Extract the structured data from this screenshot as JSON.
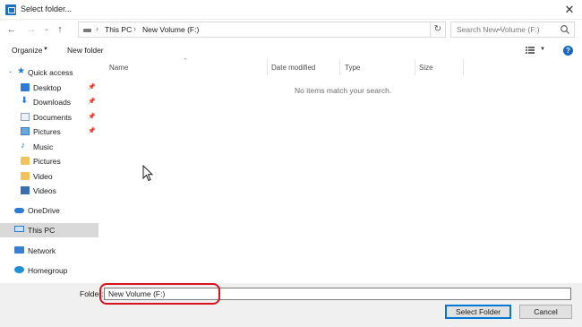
{
  "window": {
    "title": "Select folder..."
  },
  "address": {
    "segments": [
      "This PC",
      "New Volume (F:)"
    ]
  },
  "search": {
    "placeholder": "Search New Volume (F:)"
  },
  "toolbar": {
    "organize": "Organize",
    "new_folder": "New folder"
  },
  "nav": {
    "quick_access": "Quick access",
    "pinned": [
      "Desktop",
      "Downloads",
      "Documents",
      "Pictures"
    ],
    "recent": [
      "Music",
      "Pictures",
      "Video",
      "Videos"
    ],
    "onedrive": "OneDrive",
    "this_pc": "This PC",
    "network": "Network",
    "homegroup": "Homegroup"
  },
  "columns": [
    "Name",
    "Date modified",
    "Type",
    "Size"
  ],
  "empty_message": "No items match your search.",
  "footer": {
    "folder_label": "Folder:",
    "folder_value": "New Volume (F:)",
    "select_label": "Select Folder",
    "cancel_label": "Cancel"
  },
  "colors": {
    "accent": "#0078d7",
    "highlight": "#d9121b",
    "selected_bg": "#d9d9d9"
  }
}
